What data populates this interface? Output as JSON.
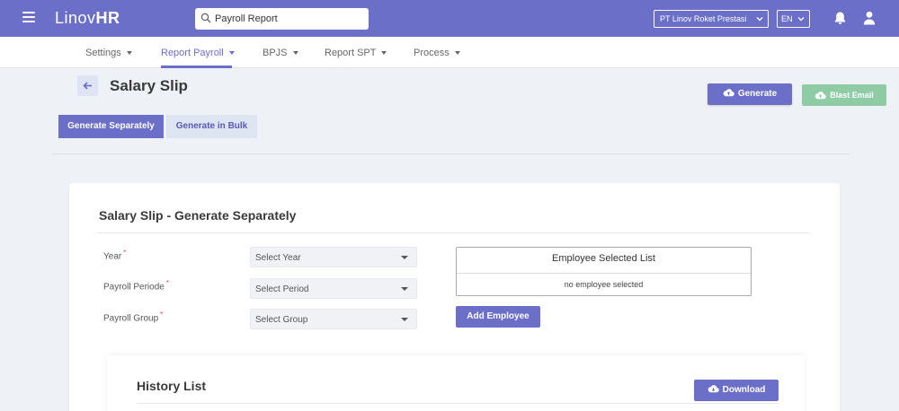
{
  "header": {
    "brand_prefix": "Linov",
    "brand_suffix": "HR",
    "search_value": "Payroll Report",
    "company": "PT Linov Roket Prestasi",
    "language": "EN"
  },
  "menu": {
    "items": [
      {
        "label": "Settings"
      },
      {
        "label": "Report Payroll"
      },
      {
        "label": "BPJS"
      },
      {
        "label": "Report SPT"
      },
      {
        "label": "Process"
      }
    ],
    "active_index": 1
  },
  "page": {
    "title": "Salary Slip",
    "generate_label": "Generate",
    "blast_email_label": "Blast Email"
  },
  "tabs": [
    {
      "label": "Generate Separately"
    },
    {
      "label": "Generate in Bulk"
    }
  ],
  "form": {
    "title": "Salary Slip - Generate Separately",
    "fields": [
      {
        "label": "Year",
        "required_mark": "*",
        "placeholder": "Select Year"
      },
      {
        "label": "Payroll Periode",
        "required_mark": "*",
        "placeholder": "Select Period"
      },
      {
        "label": "Payroll Group",
        "required_mark": "*",
        "placeholder": "Select Group"
      }
    ],
    "employee_list_title": "Employee Selected List",
    "employee_list_empty": "no employee selected",
    "add_employee_label": "Add Employee"
  },
  "history": {
    "title": "History List",
    "download_label": "Download"
  },
  "colors": {
    "primary": "#6c6fc7",
    "success_light": "#8fcca6",
    "tab_inactive_bg": "#dde5f2"
  },
  "icons": [
    "menu-icon",
    "search-icon",
    "chevron-down-icon",
    "bell-icon",
    "user-icon",
    "arrow-left-icon",
    "cloud-upload-icon",
    "cloud-download-icon"
  ]
}
